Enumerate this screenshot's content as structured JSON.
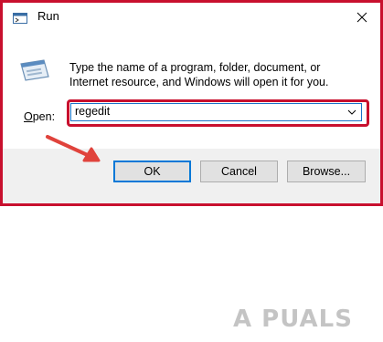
{
  "window": {
    "title": "Run",
    "icon": "run-app-icon",
    "close_icon": "close-icon"
  },
  "dialog": {
    "icon": "run-dialog-icon",
    "message": "Type the name of a program, folder, document, or Internet resource, and Windows will open it for you.",
    "open_label_prefix": "",
    "open_label_mnemonic": "O",
    "open_label_rest": "pen:",
    "input_value": "regedit",
    "dropdown_icon": "chevron-down-icon"
  },
  "buttons": {
    "ok": "OK",
    "cancel": "Cancel",
    "browse": "Browse..."
  },
  "annotation": {
    "arrow_color": "#e0433c",
    "highlight_color": "#c8102e"
  },
  "watermark": {
    "text": "A PUALS"
  },
  "colors": {
    "frame": "#c8102e",
    "focus": "#0078d7",
    "footer_bg": "#f0f0f0"
  }
}
